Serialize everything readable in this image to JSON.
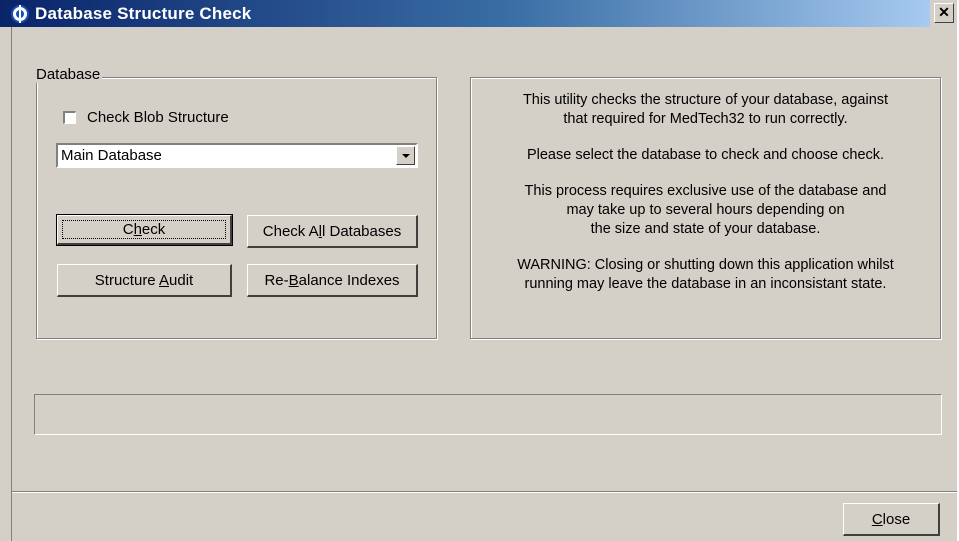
{
  "window": {
    "title": "Database Structure Check",
    "close_glyph": "✕"
  },
  "database_group": {
    "legend": "Database",
    "check_blob_structure": {
      "label": "Check Blob Structure",
      "checked": false
    },
    "database_select": {
      "value": "Main Database"
    },
    "buttons": {
      "check": {
        "pre": "C",
        "accel": "h",
        "post": "eck"
      },
      "check_all": {
        "pre": "Check A",
        "accel": "l",
        "post": "l Databases"
      },
      "structure_audit": {
        "pre": "Structure ",
        "accel": "A",
        "post": "udit"
      },
      "rebalance": {
        "pre": "Re-",
        "accel": "B",
        "post": "alance Indexes"
      }
    }
  },
  "info": {
    "paragraphs": [
      "This utility checks the structure of your database, against\nthat required for MedTech32 to run correctly.",
      "Please select the database to check and choose check.",
      "This process requires exclusive use of the database and\nmay take up to several hours depending on\nthe size and state of your database.",
      "WARNING: Closing or shutting down this application whilst\nrunning may leave the database in an inconsistant state."
    ]
  },
  "progress": {
    "value": 0
  },
  "footer": {
    "close": {
      "accel": "C",
      "post": "lose"
    }
  },
  "icons": {
    "app": "medtech-app-icon",
    "close": "close-icon",
    "dropdown": "chevron-down-icon"
  }
}
